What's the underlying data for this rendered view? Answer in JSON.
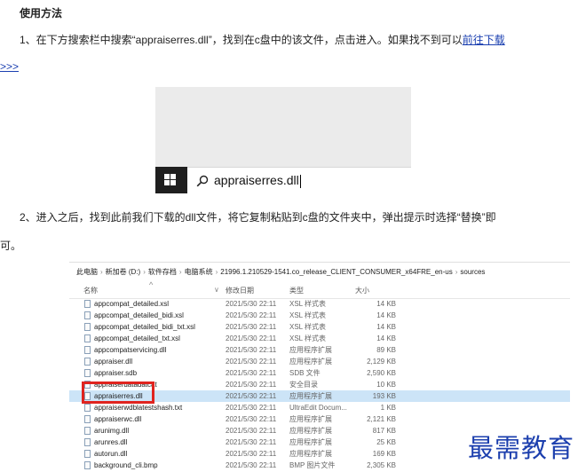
{
  "article": {
    "title": "使用方法",
    "step1_text": "1、在下方搜索栏中搜索“appraiserres.dll”，找到在c盘中的该文件，点击进入。如果找不到可以",
    "step1_link": "前往下载",
    "step1_link_cont": ">>>",
    "step2_text": "2、进入之后，找到此前我们下载的dll文件，将它复制粘贴到c盘的文件夹中，弹出提示时选择“替换”即",
    "step2_cont": "可。"
  },
  "search_screenshot": {
    "query": "appraiserres.dll",
    "icons": [
      "windows-logo-icon",
      "search-icon"
    ]
  },
  "explorer": {
    "breadcrumb": [
      "此电脑",
      "新加卷 (D:)",
      "软件存档",
      "电脑系统",
      "21996.1.210529-1541.co_release_CLIENT_CONSUMER_x64FRE_en-us",
      "sources"
    ],
    "breadcrumb_sep": "›",
    "columns": {
      "name": "名称",
      "date": "修改日期",
      "type": "类型",
      "size": "大小"
    },
    "rows": [
      {
        "name": "appcompat_detailed.xsl",
        "date": "2021/5/30 22:11",
        "type": "XSL 样式表",
        "size": "14 KB"
      },
      {
        "name": "appcompat_detailed_bidi.xsl",
        "date": "2021/5/30 22:11",
        "type": "XSL 样式表",
        "size": "14 KB"
      },
      {
        "name": "appcompat_detailed_bidi_txt.xsl",
        "date": "2021/5/30 22:11",
        "type": "XSL 样式表",
        "size": "14 KB"
      },
      {
        "name": "appcompat_detailed_txt.xsl",
        "date": "2021/5/30 22:11",
        "type": "XSL 样式表",
        "size": "14 KB"
      },
      {
        "name": "appcompatservicing.dll",
        "date": "2021/5/30 22:11",
        "type": "应用程序扩展",
        "size": "89 KB"
      },
      {
        "name": "appraiser.dll",
        "date": "2021/5/30 22:11",
        "type": "应用程序扩展",
        "size": "2,129 KB"
      },
      {
        "name": "appraiser.sdb",
        "date": "2021/5/30 22:11",
        "type": "SDB 文件",
        "size": "2,590 KB"
      },
      {
        "name": "appraiserdatadatcat",
        "date": "2021/5/30 22:11",
        "type": "安全目录",
        "size": "10 KB"
      },
      {
        "name": "appraiserres.dll",
        "date": "2021/5/30 22:11",
        "type": "应用程序扩展",
        "size": "193 KB",
        "selected": true
      },
      {
        "name": "appraiserwdblatestshash.txt",
        "date": "2021/5/30 22:11",
        "type": "UltraEdit Docum...",
        "size": "1 KB"
      },
      {
        "name": "appraiserwc.dll",
        "date": "2021/5/30 22:11",
        "type": "应用程序扩展",
        "size": "2,121 KB"
      },
      {
        "name": "arunimg.dll",
        "date": "2021/5/30 22:11",
        "type": "应用程序扩展",
        "size": "817 KB"
      },
      {
        "name": "arunres.dll",
        "date": "2021/5/30 22:11",
        "type": "应用程序扩展",
        "size": "25 KB"
      },
      {
        "name": "autorun.dll",
        "date": "2021/5/30 22:11",
        "type": "应用程序扩展",
        "size": "169 KB"
      },
      {
        "name": "background_cli.bmp",
        "date": "2021/5/30 22:11",
        "type": "BMP 图片文件",
        "size": "2,305 KB"
      }
    ],
    "highlight_color": "#e0241f"
  },
  "watermark": "最需教育"
}
